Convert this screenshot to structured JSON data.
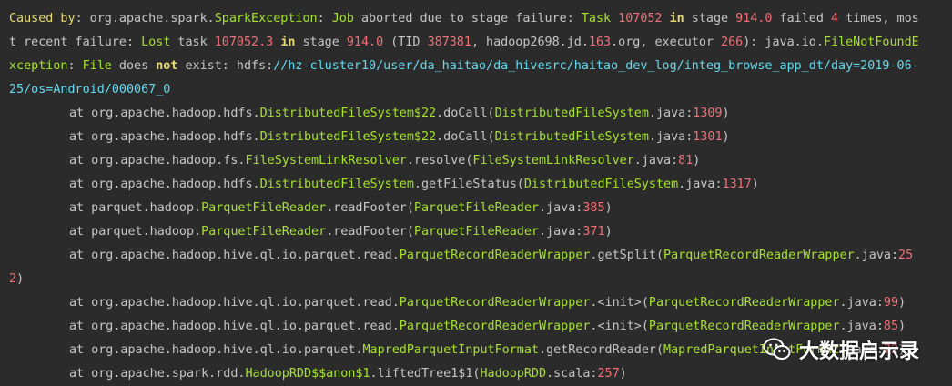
{
  "colors": {
    "background": "#2b2b2b",
    "plain": "#c6c6c6",
    "class": "#a6e22e",
    "keyword": "#e6db74",
    "number": "#f07178",
    "link": "#66d9ef"
  },
  "lines": [
    {
      "indent": false,
      "segments": [
        {
          "t": "Caused by",
          "c": "head"
        },
        {
          "t": ": org.apache.spark.",
          "c": "plain"
        },
        {
          "t": "SparkException",
          "c": "class"
        },
        {
          "t": ": ",
          "c": "plain"
        },
        {
          "t": "Job",
          "c": "class"
        },
        {
          "t": " aborted due to stage failure: ",
          "c": "plain"
        },
        {
          "t": "Task",
          "c": "class"
        },
        {
          "t": " ",
          "c": "plain"
        },
        {
          "t": "107052",
          "c": "num"
        },
        {
          "t": " ",
          "c": "plain"
        },
        {
          "t": "in",
          "c": "kw"
        },
        {
          "t": " stage ",
          "c": "plain"
        },
        {
          "t": "914.0",
          "c": "num"
        },
        {
          "t": " failed ",
          "c": "plain"
        },
        {
          "t": "4",
          "c": "num"
        },
        {
          "t": " times, mos",
          "c": "plain"
        }
      ]
    },
    {
      "indent": false,
      "segments": [
        {
          "t": "t recent failure: ",
          "c": "plain"
        },
        {
          "t": "Lost",
          "c": "class"
        },
        {
          "t": " task ",
          "c": "plain"
        },
        {
          "t": "107052.3",
          "c": "num"
        },
        {
          "t": " ",
          "c": "plain"
        },
        {
          "t": "in",
          "c": "kw"
        },
        {
          "t": " stage ",
          "c": "plain"
        },
        {
          "t": "914.0",
          "c": "num"
        },
        {
          "t": " (TID ",
          "c": "plain"
        },
        {
          "t": "387381",
          "c": "num"
        },
        {
          "t": ", hadoop2698.jd.",
          "c": "plain"
        },
        {
          "t": "163",
          "c": "num"
        },
        {
          "t": ".org, executor ",
          "c": "plain"
        },
        {
          "t": "266",
          "c": "num"
        },
        {
          "t": "): java.io.",
          "c": "plain"
        },
        {
          "t": "FileNotFoundE",
          "c": "class"
        }
      ]
    },
    {
      "indent": false,
      "segments": [
        {
          "t": "xception",
          "c": "class"
        },
        {
          "t": ": ",
          "c": "plain"
        },
        {
          "t": "File",
          "c": "class"
        },
        {
          "t": " does ",
          "c": "plain"
        },
        {
          "t": "not",
          "c": "kw"
        },
        {
          "t": " exist: hdfs:",
          "c": "plain"
        },
        {
          "t": "//hz-cluster10/user/da_haitao/da_hivesrc/haitao_dev_log/integ_browse_app_dt/day=2019-06-",
          "c": "link"
        }
      ]
    },
    {
      "indent": false,
      "segments": [
        {
          "t": "25/os=Android/000067_0",
          "c": "link"
        }
      ]
    },
    {
      "indent": true,
      "segments": [
        {
          "t": "at org.apache.hadoop.hdfs.",
          "c": "plain"
        },
        {
          "t": "DistributedFileSystem$22",
          "c": "class"
        },
        {
          "t": ".doCall(",
          "c": "plain"
        },
        {
          "t": "DistributedFileSystem",
          "c": "class"
        },
        {
          "t": ".java:",
          "c": "plain"
        },
        {
          "t": "1309",
          "c": "num"
        },
        {
          "t": ")",
          "c": "plain"
        }
      ]
    },
    {
      "indent": true,
      "segments": [
        {
          "t": "at org.apache.hadoop.hdfs.",
          "c": "plain"
        },
        {
          "t": "DistributedFileSystem$22",
          "c": "class"
        },
        {
          "t": ".doCall(",
          "c": "plain"
        },
        {
          "t": "DistributedFileSystem",
          "c": "class"
        },
        {
          "t": ".java:",
          "c": "plain"
        },
        {
          "t": "1301",
          "c": "num"
        },
        {
          "t": ")",
          "c": "plain"
        }
      ]
    },
    {
      "indent": true,
      "segments": [
        {
          "t": "at org.apache.hadoop.fs.",
          "c": "plain"
        },
        {
          "t": "FileSystemLinkResolver",
          "c": "class"
        },
        {
          "t": ".resolve(",
          "c": "plain"
        },
        {
          "t": "FileSystemLinkResolver",
          "c": "class"
        },
        {
          "t": ".java:",
          "c": "plain"
        },
        {
          "t": "81",
          "c": "num"
        },
        {
          "t": ")",
          "c": "plain"
        }
      ]
    },
    {
      "indent": true,
      "segments": [
        {
          "t": "at org.apache.hadoop.hdfs.",
          "c": "plain"
        },
        {
          "t": "DistributedFileSystem",
          "c": "class"
        },
        {
          "t": ".getFileStatus(",
          "c": "plain"
        },
        {
          "t": "DistributedFileSystem",
          "c": "class"
        },
        {
          "t": ".java:",
          "c": "plain"
        },
        {
          "t": "1317",
          "c": "num"
        },
        {
          "t": ")",
          "c": "plain"
        }
      ]
    },
    {
      "indent": true,
      "segments": [
        {
          "t": "at parquet.hadoop.",
          "c": "plain"
        },
        {
          "t": "ParquetFileReader",
          "c": "class"
        },
        {
          "t": ".readFooter(",
          "c": "plain"
        },
        {
          "t": "ParquetFileReader",
          "c": "class"
        },
        {
          "t": ".java:",
          "c": "plain"
        },
        {
          "t": "385",
          "c": "num"
        },
        {
          "t": ")",
          "c": "plain"
        }
      ]
    },
    {
      "indent": true,
      "segments": [
        {
          "t": "at parquet.hadoop.",
          "c": "plain"
        },
        {
          "t": "ParquetFileReader",
          "c": "class"
        },
        {
          "t": ".readFooter(",
          "c": "plain"
        },
        {
          "t": "ParquetFileReader",
          "c": "class"
        },
        {
          "t": ".java:",
          "c": "plain"
        },
        {
          "t": "371",
          "c": "num"
        },
        {
          "t": ")",
          "c": "plain"
        }
      ]
    },
    {
      "indent": true,
      "segments": [
        {
          "t": "at org.apache.hadoop.hive.ql.io.parquet.read.",
          "c": "plain"
        },
        {
          "t": "ParquetRecordReaderWrapper",
          "c": "class"
        },
        {
          "t": ".getSplit(",
          "c": "plain"
        },
        {
          "t": "ParquetRecordReaderWrapper",
          "c": "class"
        },
        {
          "t": ".java:",
          "c": "plain"
        },
        {
          "t": "25",
          "c": "num"
        }
      ]
    },
    {
      "indent": false,
      "segments": [
        {
          "t": "2",
          "c": "num"
        },
        {
          "t": ")",
          "c": "plain"
        }
      ]
    },
    {
      "indent": true,
      "segments": [
        {
          "t": "at org.apache.hadoop.hive.ql.io.parquet.read.",
          "c": "plain"
        },
        {
          "t": "ParquetRecordReaderWrapper",
          "c": "class"
        },
        {
          "t": ".<init>(",
          "c": "plain"
        },
        {
          "t": "ParquetRecordReaderWrapper",
          "c": "class"
        },
        {
          "t": ".java:",
          "c": "plain"
        },
        {
          "t": "99",
          "c": "num"
        },
        {
          "t": ")",
          "c": "plain"
        }
      ]
    },
    {
      "indent": true,
      "segments": [
        {
          "t": "at org.apache.hadoop.hive.ql.io.parquet.read.",
          "c": "plain"
        },
        {
          "t": "ParquetRecordReaderWrapper",
          "c": "class"
        },
        {
          "t": ".<init>(",
          "c": "plain"
        },
        {
          "t": "ParquetRecordReaderWrapper",
          "c": "class"
        },
        {
          "t": ".java:",
          "c": "plain"
        },
        {
          "t": "85",
          "c": "num"
        },
        {
          "t": ")",
          "c": "plain"
        }
      ]
    },
    {
      "indent": true,
      "segments": [
        {
          "t": "at org.apache.hadoop.hive.ql.io.parquet.",
          "c": "plain"
        },
        {
          "t": "MapredParquetInputFormat",
          "c": "class"
        },
        {
          "t": ".getRecordReader(",
          "c": "plain"
        },
        {
          "t": "MapredParquetInputFormat",
          "c": "class"
        },
        {
          "t": ".java:",
          "c": "plain"
        },
        {
          "t": "72",
          "c": "num"
        },
        {
          "t": ")",
          "c": "plain"
        }
      ]
    },
    {
      "indent": true,
      "segments": [
        {
          "t": "at org.apache.spark.rdd.",
          "c": "plain"
        },
        {
          "t": "HadoopRDD$$anon$1",
          "c": "class"
        },
        {
          "t": ".liftedTree1$1(",
          "c": "plain"
        },
        {
          "t": "HadoopRDD",
          "c": "class"
        },
        {
          "t": ".scala:",
          "c": "plain"
        },
        {
          "t": "257",
          "c": "num"
        },
        {
          "t": ")",
          "c": "plain"
        }
      ]
    }
  ],
  "watermark": {
    "icon": "wechat-icon",
    "text": "大数据启示录"
  }
}
